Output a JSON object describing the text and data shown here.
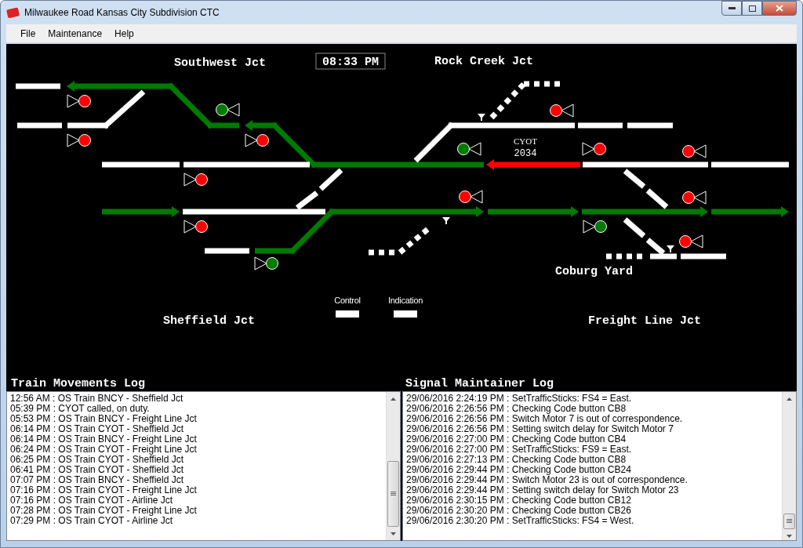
{
  "window": {
    "title": "Milwaukee Road Kansas City Subdivision CTC"
  },
  "menu": [
    "File",
    "Maintenance",
    "Help"
  ],
  "diagram": {
    "clock": "08:33 PM",
    "locations": [
      {
        "name": "Southwest Jct"
      },
      {
        "name": "Rock Creek Jct"
      },
      {
        "name": "Coburg Yard"
      },
      {
        "name": "Sheffield Jct"
      },
      {
        "name": "Freight Line Jct"
      }
    ],
    "train_tag": {
      "symbol": "CYOT",
      "number": "2034"
    },
    "signals": [
      {
        "color": "#ff0000"
      },
      {
        "color": "#ff0000"
      },
      {
        "color": "#007a00"
      },
      {
        "color": "#ff0000"
      },
      {
        "color": "#ff0000"
      },
      {
        "color": "#ff0000"
      },
      {
        "color": "#007a00"
      },
      {
        "color": "#ff0000"
      },
      {
        "color": "#007a00"
      },
      {
        "color": "#ff0000"
      },
      {
        "color": "#ff0000"
      },
      {
        "color": "#ff0000"
      },
      {
        "color": "#ff0000"
      },
      {
        "color": "#007a00"
      },
      {
        "color": "#ff0000"
      }
    ],
    "tracks": [
      {
        "color": "#ffffff"
      },
      {
        "color": "#007a00"
      },
      {
        "color": "#ffffff"
      },
      {
        "color": "#ffffff"
      },
      {
        "color": "#007a00"
      },
      {
        "color": "#ffffff"
      },
      {
        "color": "#ffffff"
      },
      {
        "color": "#ff0000"
      },
      {
        "color": "#ffffff"
      },
      {
        "color": "#ffffff"
      },
      {
        "color": "#ffffff"
      },
      {
        "color": "#ffffff"
      },
      {
        "color": "#007a00"
      },
      {
        "color": "#ffffff"
      },
      {
        "color": "#007a00"
      },
      {
        "color": "#007a00"
      },
      {
        "color": "#007a00"
      },
      {
        "color": "#007a00"
      },
      {
        "color": "#ffffff"
      },
      {
        "color": "#ffffff"
      },
      {
        "color": "#ffffff"
      },
      {
        "color": "#ffffff"
      },
      {
        "color": "#ffffff"
      },
      {
        "color": "#ffffff"
      },
      {
        "color": "#ffffff"
      },
      {
        "color": "#ffffff"
      },
      {
        "color": "#ffffff"
      },
      {
        "color": "#ffffff"
      },
      {
        "color": "#ffffff"
      },
      {
        "color": "#ffffff"
      },
      {
        "color": "#ffffff"
      }
    ],
    "legend": [
      {
        "label": "Control"
      },
      {
        "label": "Indication"
      }
    ]
  },
  "logs": [
    {
      "title": "Train Movements Log",
      "entries": [
        "12:56 AM : OS Train BNCY - Sheffield Jct",
        "05:39 PM : CYOT called, on duty.",
        "05:53 PM : OS Train BNCY - Freight Line Jct",
        "06:14 PM : OS Train CYOT - Sheffield Jct",
        "06:14 PM : OS Train BNCY - Freight Line Jct",
        "06:24 PM : OS Train CYOT - Freight Line Jct",
        "06:25 PM : OS Train CYOT - Sheffield Jct",
        "06:41 PM : OS Train CYOT - Sheffield Jct",
        "07:07 PM : OS Train BNCY - Sheffield Jct",
        "07:16 PM : OS Train CYOT - Freight Line Jct",
        "07:16 PM : OS Train CYOT - Airline Jct",
        "07:28 PM : OS Train CYOT - Freight Line Jct",
        "07:29 PM : OS Train CYOT - Airline Jct"
      ]
    },
    {
      "title": "Signal Maintainer Log",
      "entries": [
        "29/06/2016 2:24:19 PM : SetTrafficSticks: FS4 = East.",
        "29/06/2016 2:26:56 PM : Checking Code button CB8",
        "29/06/2016 2:26:56 PM : Switch Motor 7 is out of correspondence.",
        "29/06/2016 2:26:56 PM : Setting switch delay for Switch Motor 7",
        "29/06/2016 2:27:00 PM : Checking Code button CB4",
        "29/06/2016 2:27:00 PM : SetTrafficSticks: FS9 = East.",
        "29/06/2016 2:27:13 PM : Checking Code button CB8",
        "29/06/2016 2:29:44 PM : Checking Code button CB24",
        "29/06/2016 2:29:44 PM : Switch Motor 23 is out of correspondence.",
        "29/06/2016 2:29:44 PM : Setting switch delay for Switch Motor 23",
        "29/06/2016 2:30:15 PM : Checking Code button CB12",
        "29/06/2016 2:30:20 PM : Checking Code button CB26",
        "29/06/2016 2:30:20 PM : SetTrafficSticks: FS4 = West."
      ]
    }
  ]
}
